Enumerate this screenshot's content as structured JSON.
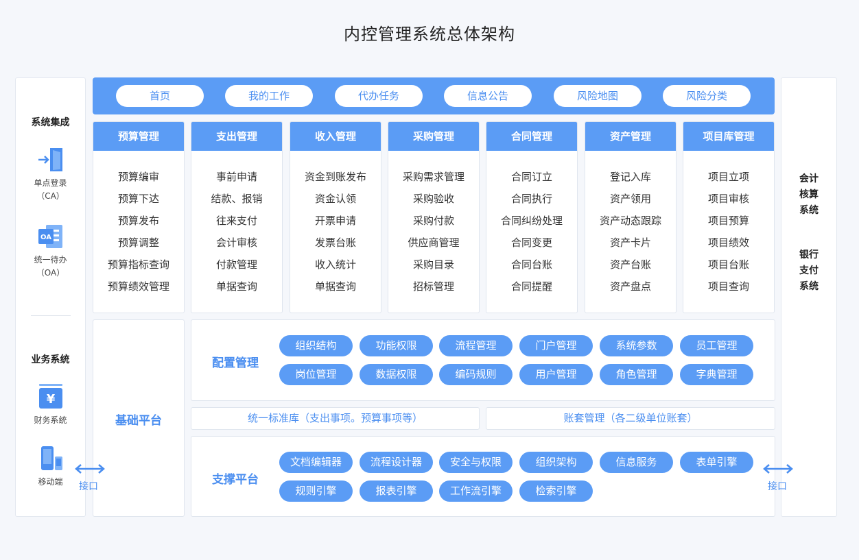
{
  "title": "内控管理系统总体架构",
  "colors": {
    "primary": "#5b9cf5",
    "accent_text": "#4a8ef0",
    "background": "#f5f7fb"
  },
  "left": {
    "integration_heading": "系统集成",
    "integration_items": [
      {
        "line1": "单点登录",
        "line2": "（CA）",
        "icon": "login-door-icon"
      },
      {
        "line1": "统一待办",
        "line2": "（OA）",
        "icon": "oa-document-icon"
      }
    ],
    "business_heading": "业务系统",
    "business_items": [
      {
        "label": "财务系统",
        "icon": "yuan-finance-icon"
      },
      {
        "label": "移动端",
        "icon": "mobile-device-icon"
      }
    ]
  },
  "right": {
    "blocks": [
      {
        "lines": [
          "会计",
          "核算",
          "系统"
        ]
      },
      {
        "lines": [
          "银行",
          "支付",
          "系统"
        ]
      }
    ]
  },
  "nav": [
    "首页",
    "我的工作",
    "代办任务",
    "信息公告",
    "风险地图",
    "风险分类"
  ],
  "modules": [
    {
      "title": "预算管理",
      "items": [
        "预算编审",
        "预算下达",
        "预算发布",
        "预算调整",
        "预算指标查询",
        "预算绩效管理"
      ]
    },
    {
      "title": "支出管理",
      "items": [
        "事前申请",
        "结款、报销",
        "往来支付",
        "会计审核",
        "付款管理",
        "单据查询"
      ]
    },
    {
      "title": "收入管理",
      "items": [
        "资金到账发布",
        "资金认领",
        "开票申请",
        "发票台账",
        "收入统计",
        "单据查询"
      ]
    },
    {
      "title": "采购管理",
      "items": [
        "采购需求管理",
        "采购验收",
        "采购付款",
        "供应商管理",
        "采购目录",
        "招标管理"
      ]
    },
    {
      "title": "合同管理",
      "items": [
        "合同订立",
        "合同执行",
        "合同纠纷处理",
        "合同变更",
        "合同台账",
        "合同提醒"
      ]
    },
    {
      "title": "资产管理",
      "items": [
        "登记入库",
        "资产领用",
        "资产动态跟踪",
        "资产卡片",
        "资产台账",
        "资产盘点"
      ]
    },
    {
      "title": "项目库管理",
      "items": [
        "项目立项",
        "项目审核",
        "项目预算",
        "项目绩效",
        "项目台账",
        "项目查询"
      ]
    }
  ],
  "base_platform": {
    "label": "基础平台"
  },
  "config": {
    "label": "配置管理",
    "items": [
      "组织结构",
      "功能权限",
      "流程管理",
      "门户管理",
      "系统参数",
      "员工管理",
      "岗位管理",
      "数据权限",
      "编码规则",
      "用户管理",
      "角色管理",
      "字典管理"
    ]
  },
  "standard_lib": "统一标准库（支出事项。预算事项等）",
  "account_mgmt": "账套管理（各二级单位账套）",
  "support": {
    "label": "支撑平台",
    "items": [
      "文档编辑器",
      "流程设计器",
      "安全与权限",
      "组织架构",
      "信息服务",
      "表单引擎",
      "规则引擎",
      "报表引擎",
      "工作流引擎",
      "检索引擎"
    ]
  },
  "interface_label": "接口"
}
